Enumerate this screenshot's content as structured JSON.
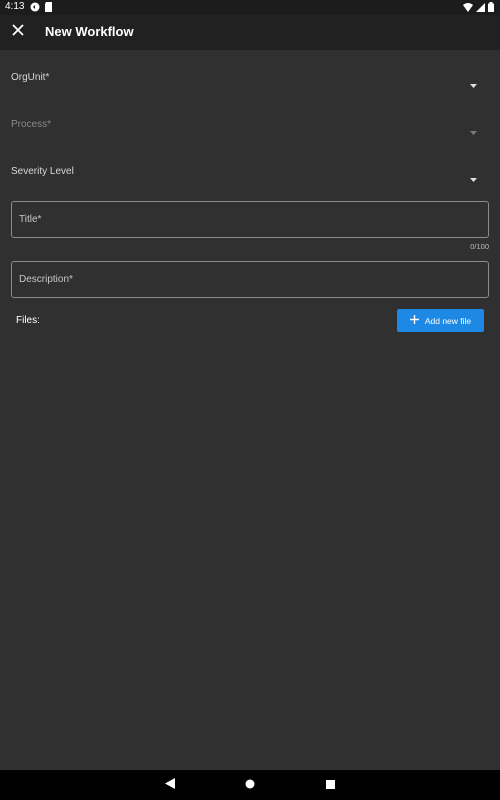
{
  "status_bar": {
    "time": "4:13",
    "left_icons": [
      "sync-icon",
      "sd-card-icon"
    ],
    "right_icons": [
      "wifi-icon",
      "signal-icon",
      "battery-icon"
    ]
  },
  "app_bar": {
    "close_icon": "close-icon",
    "title": "New Workflow"
  },
  "form": {
    "org_unit": {
      "label": "OrgUnit*",
      "icon": "arrow-drop-down-icon"
    },
    "process": {
      "label": "Process*",
      "icon": "arrow-drop-down-icon",
      "disabled": true
    },
    "severity": {
      "label": "Severity Level",
      "icon": "arrow-drop-down-icon"
    },
    "title": {
      "placeholder": "Title*",
      "counter": "0/100"
    },
    "description": {
      "placeholder": "Description*"
    },
    "files": {
      "label": "Files:",
      "add_button": "Add new file",
      "add_icon": "plus-icon"
    }
  },
  "nav_bar": {
    "icons": [
      "back-icon",
      "home-icon",
      "recents-icon"
    ]
  },
  "colors": {
    "background": "#303030",
    "app_bar": "#212121",
    "accent": "#1e88e5",
    "nav_bar": "#000000"
  }
}
